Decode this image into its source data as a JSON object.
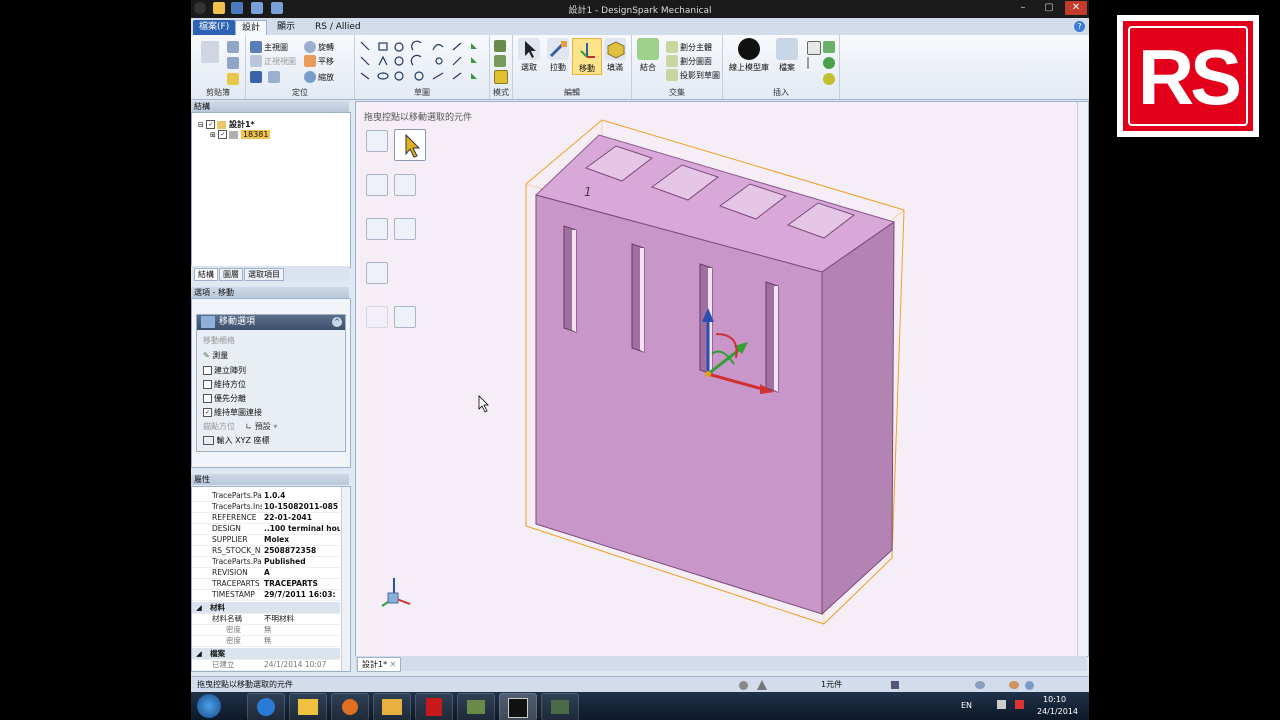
{
  "window": {
    "title": "設計1 - DesignSpark  Mechanical"
  },
  "menu_tabs": [
    {
      "label": "檔案(F)"
    },
    {
      "label": "設計"
    },
    {
      "label": "顯示"
    },
    {
      "label": "RS / Allied"
    }
  ],
  "ribbon": {
    "groups": {
      "clipboard": "剪貼簿",
      "orient": "定位",
      "sketch": "草圖",
      "mode": "模式",
      "edit": "編輯",
      "intersect": "交集",
      "insert": "插入"
    },
    "orient_items": [
      "主視圖",
      "旋轉",
      "正視視圖",
      "平移",
      "縮放"
    ],
    "edit_buttons": [
      "選取",
      "拉動",
      "移動",
      "填滿"
    ],
    "combine": "結合",
    "split_items": [
      "劃分主體",
      "劃分圖面",
      "投影到草圖"
    ],
    "online": "線上模型庫",
    "file_btn": "檔案"
  },
  "structure_panel": {
    "title": "結構",
    "root": "設計1*",
    "child": "18381",
    "tabs": [
      "結構",
      "圖層",
      "選取項目"
    ]
  },
  "options_panel": {
    "title": "選項 - 移動",
    "header": "移動選項",
    "items": [
      {
        "label": "移動柵格",
        "checked": false,
        "disabled": true
      },
      {
        "label": "測量",
        "checked": false,
        "disabled": false
      },
      {
        "label": "建立陣列",
        "checked": false
      },
      {
        "label": "維持方位",
        "checked": false
      },
      {
        "label": "優先分離",
        "checked": false
      },
      {
        "label": "維持草圖連接",
        "checked": true
      }
    ],
    "anchor_label": "錨點方位",
    "default_label": "預設",
    "xyz_label": "輸入 XYZ 座標"
  },
  "properties_panel": {
    "title": "屬性",
    "rows": [
      {
        "k": "TraceParts.Pa",
        "v": "1.0.4"
      },
      {
        "k": "TraceParts.Ins",
        "v": "10-15082011-085"
      },
      {
        "k": "REFERENCE",
        "v": "22-01-2041"
      },
      {
        "k": "DESIGN",
        "v": "..100 terminal hou"
      },
      {
        "k": "SUPPLIER",
        "v": "Molex"
      },
      {
        "k": "RS_STOCK_N",
        "v": "2508872358"
      },
      {
        "k": "TraceParts.Pa",
        "v": "Published"
      },
      {
        "k": "REVISION",
        "v": "A"
      },
      {
        "k": "TRACEPARTS",
        "v": "TRACEPARTS"
      },
      {
        "k": "TIMESTAMP",
        "v": "29/7/2011 16:03:"
      }
    ],
    "material_group": "材料",
    "material_rows": [
      {
        "k": "材料名稱",
        "v": "不明材料"
      },
      {
        "k": "密度",
        "v": "無"
      },
      {
        "k": "密度",
        "v": "無"
      }
    ],
    "file_group": "檔案",
    "file_rows": [
      {
        "k": "已建立",
        "v": "24/1/2014 10:07"
      }
    ]
  },
  "canvas": {
    "hint": "拖曳控點以移動選取的元件",
    "label_one": "1"
  },
  "doc_tab": {
    "label": "設計1*"
  },
  "status": {
    "text": "拖曳控點以移動選取的元件",
    "selection": "1元件"
  },
  "taskbar": {
    "lang": "EN",
    "time": "10:10",
    "date": "24/1/2014"
  },
  "logo": {
    "text": "RS"
  },
  "colors": {
    "accent": "#2d62b6",
    "selection": "#f3c453",
    "part_face": "#c896c8",
    "bbox": "#f0a020",
    "rs_red": "#e3001b"
  }
}
